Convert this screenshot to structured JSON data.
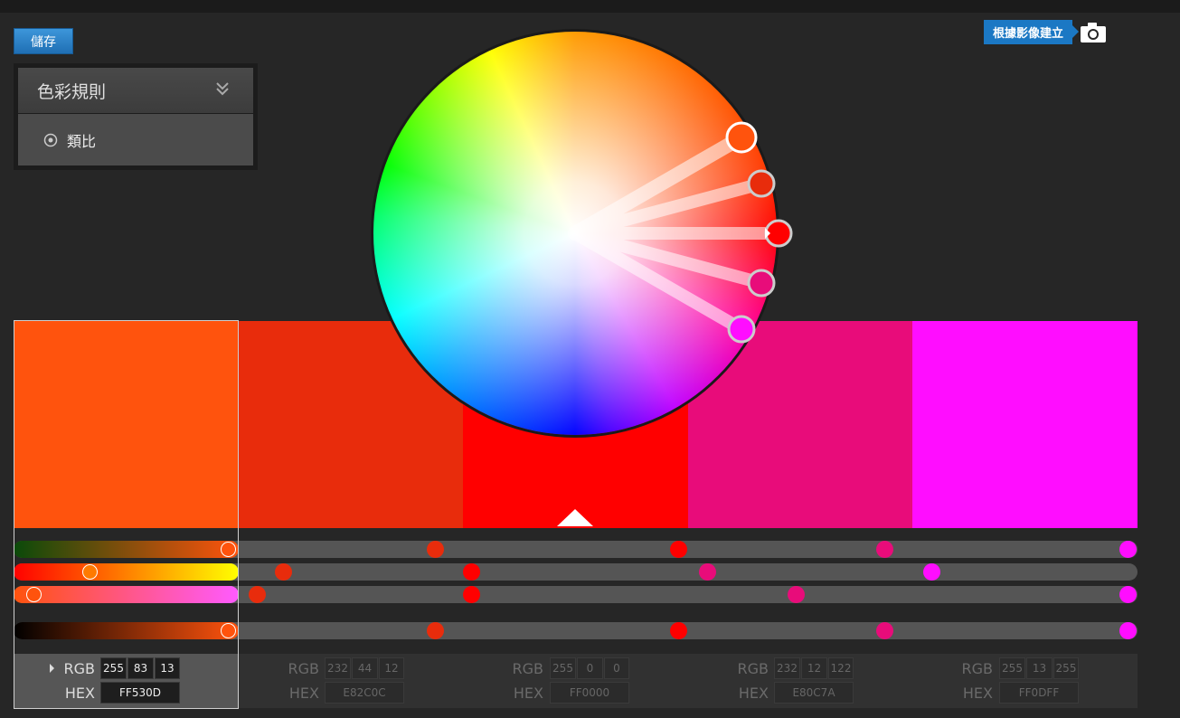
{
  "toolbar": {
    "save_label": "儲存"
  },
  "rules_panel": {
    "title": "色彩規則",
    "selected_rule": "類比",
    "chevron_icon": "double-chevron-down-icon",
    "radio_icon": "radio-selected-icon"
  },
  "capture": {
    "label": "根據影像建立",
    "icon": "camera-icon"
  },
  "swatches": [
    {
      "color": "#FF530D",
      "rgb": [
        "255",
        "83",
        "13"
      ],
      "hex": "FF530D"
    },
    {
      "color": "#E82C0C",
      "rgb": [
        "232",
        "44",
        "12"
      ],
      "hex": "E82C0C"
    },
    {
      "color": "#FF0000",
      "rgb": [
        "255",
        "0",
        "0"
      ],
      "hex": "FF0000"
    },
    {
      "color": "#E80C7A",
      "rgb": [
        "232",
        "12",
        "122"
      ],
      "hex": "E80C7A"
    },
    {
      "color": "#FF0DFF",
      "rgb": [
        "255",
        "13",
        "255"
      ],
      "hex": "FF0DFF"
    }
  ],
  "labels": {
    "rgb": "RGB",
    "hex": "HEX"
  },
  "selected_index": 0
}
